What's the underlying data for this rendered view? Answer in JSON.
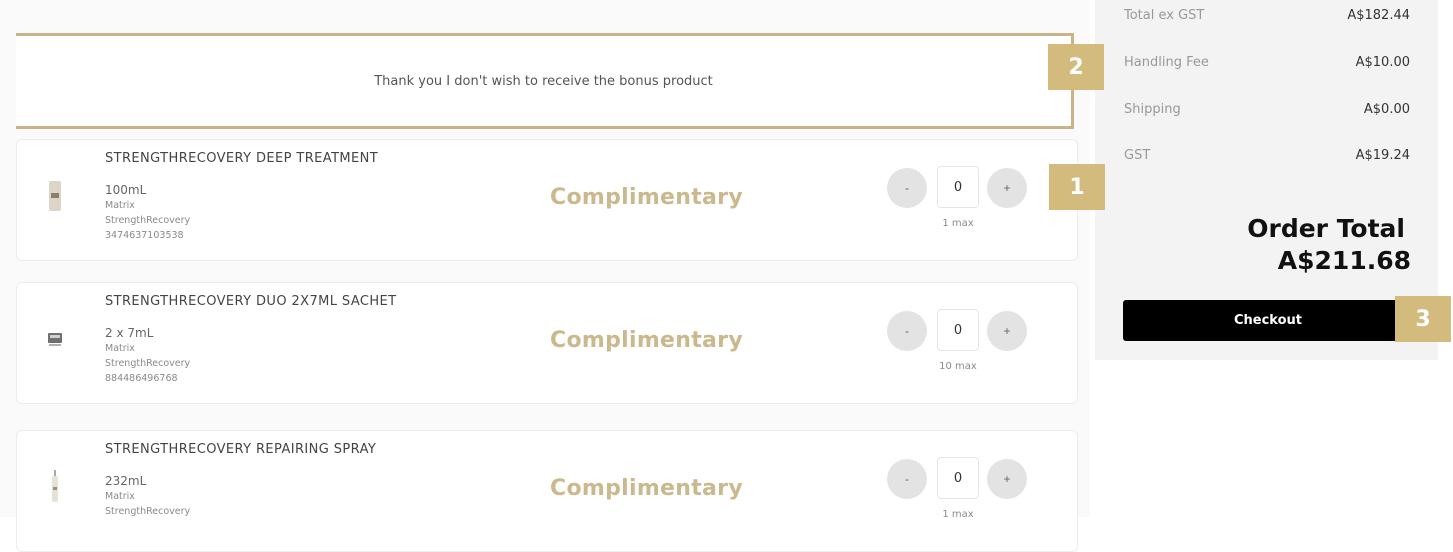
{
  "decline": {
    "text": "Thank you I don't wish to receive the bonus product"
  },
  "products": [
    {
      "name": "STRENGTHRECOVERY DEEP TREATMENT",
      "size": "100mL",
      "brand": "Matrix",
      "line": "StrengthRecovery",
      "sku": "3474637103538",
      "price": "Complimentary",
      "qty": "0",
      "minus": "-",
      "plus": "+",
      "max": "1 max"
    },
    {
      "name": "STRENGTHRECOVERY DUO 2X7ML SACHET",
      "size": "2 x 7mL",
      "brand": "Matrix",
      "line": "StrengthRecovery",
      "sku": "884486496768",
      "price": "Complimentary",
      "qty": "0",
      "minus": "-",
      "plus": "+",
      "max": "10 max"
    },
    {
      "name": "STRENGTHRECOVERY REPAIRING SPRAY",
      "size": "232mL",
      "brand": "Matrix",
      "line": "StrengthRecovery",
      "sku": "",
      "price": "Complimentary",
      "qty": "0",
      "minus": "-",
      "plus": "+",
      "max": "1 max"
    }
  ],
  "summary": {
    "rows": [
      {
        "label": "Total ex GST",
        "value": "A$182.44"
      },
      {
        "label": "Handling Fee",
        "value": "A$10.00"
      },
      {
        "label": "Shipping",
        "value": "A$0.00"
      },
      {
        "label": "GST",
        "value": "A$19.24"
      }
    ],
    "order_total_label": "Order Total",
    "order_total_value": "A$211.68",
    "checkout_label": "Checkout"
  },
  "markers": [
    "1",
    "2",
    "3"
  ],
  "colors": {
    "accent": "#d2bb7c",
    "complimentary": "#cbb98e",
    "checkout_bg": "#000000"
  }
}
